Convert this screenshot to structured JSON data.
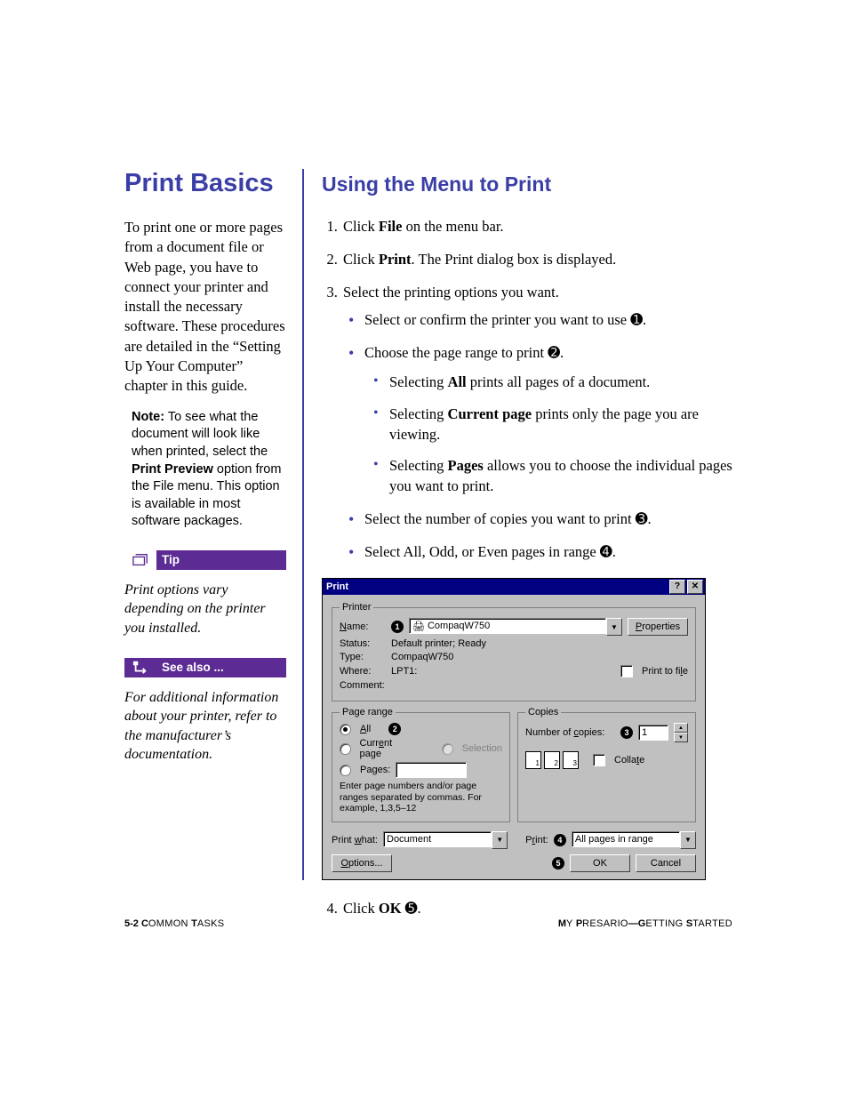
{
  "left": {
    "heading": "Print Basics",
    "intro": "To print one or more pages from a document file or Web page, you have to connect your printer and install the necessary software. These procedures are detailed in the “Setting Up Your Computer” chapter in this guide.",
    "note_label": "Note:",
    "note_text_a": " To see what the document will look like when printed, select the ",
    "note_bold": "Print Preview",
    "note_text_b": " option from the File menu. This option is available in most software packages.",
    "tip_label": "Tip",
    "tip_text": "Print options vary depending on the printer you installed.",
    "see_label": "See also ...",
    "see_text": "For additional information about your printer, refer to the manufacturer’s documentation."
  },
  "right": {
    "heading": "Using the Menu to Print",
    "steps": {
      "s1a": "Click ",
      "s1b": "File",
      "s1c": " on the menu bar.",
      "s2a": "Click ",
      "s2b": "Print",
      "s2c": ". The Print dialog box is displayed.",
      "s3": "Select the printing options you want.",
      "b1": "Select or confirm the printer you want to use ",
      "b2": "Choose the page range to print ",
      "sb1a": "Selecting ",
      "sb1b": "All",
      "sb1c": " prints all pages of a document.",
      "sb2a": "Selecting ",
      "sb2b": "Current page",
      "sb2c": " prints only the page you are viewing.",
      "sb3a": "Selecting ",
      "sb3b": "Pages",
      "sb3c": " allows you to choose the individual pages you want to print.",
      "b3": "Select the number of copies you want to print ",
      "b4": "Select All, Odd, or Even pages in range ",
      "s4a": "Click ",
      "s4b": "OK",
      "s4c": " "
    },
    "callouts": {
      "c1": "➊",
      "c2": "➋",
      "c3": "➌",
      "c4": "➍",
      "c5": "➎"
    }
  },
  "dialog": {
    "title": "Print",
    "help_btn": "?",
    "close_btn": "✕",
    "printer_group": "Printer",
    "name_label": "Name:",
    "name_value": "CompaqW750",
    "properties_btn": "Properties",
    "status_label": "Status:",
    "status_value": "Default printer; Ready",
    "type_label": "Type:",
    "type_value": "CompaqW750",
    "where_label": "Where:",
    "where_value": "LPT1:",
    "comment_label": "Comment:",
    "comment_value": "",
    "print_to_file": "Print to file",
    "range_group": "Page range",
    "all_label": "All",
    "current_label": "Current page",
    "selection_label": "Selection",
    "pages_label": "Pages:",
    "pages_hint": "Enter page numbers and/or page ranges separated by commas. For example, 1,3,5–12",
    "copies_group": "Copies",
    "num_copies_label": "Number of copies:",
    "num_copies_value": "1",
    "collate_label": "Collate",
    "print_what_label": "Print what:",
    "print_what_value": "Document",
    "print_label": "Print:",
    "print_value": "All pages in range",
    "options_btn": "Options...",
    "ok_btn": "OK",
    "cancel_btn": "Cancel"
  },
  "footer": {
    "left_a": "5-2 C",
    "left_b": "OMMON ",
    "left_c": "T",
    "left_d": "ASKS",
    "right_a": "M",
    "right_b": "Y ",
    "right_c": "P",
    "right_d": "RESARIO",
    "right_e": "—G",
    "right_f": "ETTING ",
    "right_g": "S",
    "right_h": "TARTED"
  }
}
